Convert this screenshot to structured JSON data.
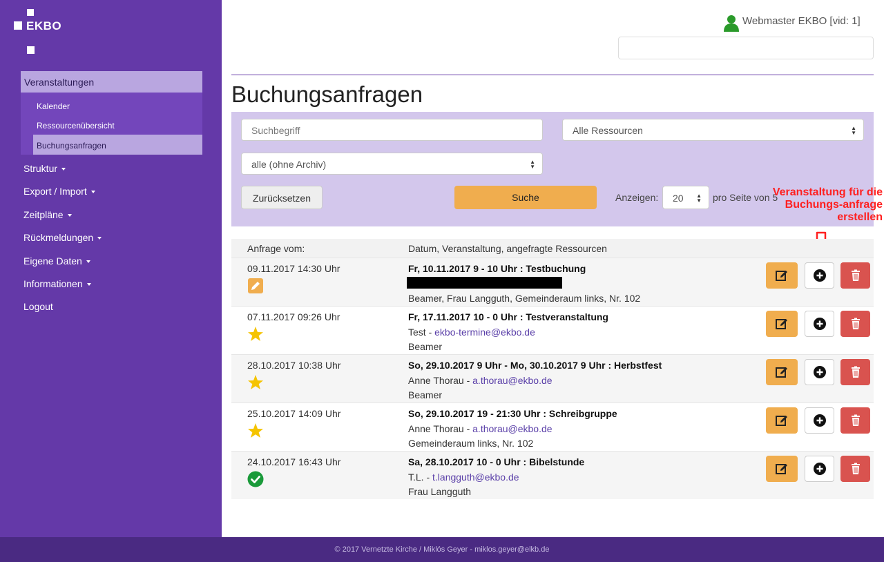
{
  "brand": {
    "logo_text": "EKBO"
  },
  "sidebar": {
    "main": "Veranstaltungen",
    "sub": [
      "Kalender",
      "Ressourcenübersicht",
      "Buchungsanfragen"
    ],
    "items": [
      "Struktur",
      "Export / Import",
      "Zeitpläne",
      "Rückmeldungen",
      "Eigene Daten",
      "Informationen",
      "Logout"
    ]
  },
  "user": {
    "name": "Webmaster EKBO [vid: 1]"
  },
  "page": {
    "title": "Buchungsanfragen"
  },
  "filter": {
    "search_placeholder": "Suchbegriff",
    "resources": "Alle Ressourcen",
    "archive": "alle (ohne Archiv)",
    "reset_label": "Zurücksetzen",
    "search_label": "Suche",
    "show_label": "Anzeigen:",
    "per_page_value": "20",
    "per_page_suffix": "pro Seite von 5"
  },
  "annotation": {
    "text": "Veranstaltung für die Buchungs-anfrage erstellen"
  },
  "table": {
    "col1": "Anfrage vom:",
    "col2": "Datum, Veranstaltung, angefragte Ressourcen",
    "rows": [
      {
        "date": "09.11.2017 14:30 Uhr",
        "status": "edit",
        "title": "Fr, 10.11.2017 9 - 10 Uhr : Testbuchung",
        "contact": "",
        "email": "",
        "resources": "Beamer, Frau Langguth, Gemeinderaum links, Nr. 102"
      },
      {
        "date": "07.11.2017 09:26 Uhr",
        "status": "star",
        "title": "Fr, 17.11.2017 10 - 0 Uhr : Testveranstaltung",
        "contact": "Test - ",
        "email": "ekbo-termine@ekbo.de",
        "resources": "Beamer"
      },
      {
        "date": "28.10.2017 10:38 Uhr",
        "status": "star",
        "title": "So, 29.10.2017 9 Uhr - Mo, 30.10.2017 9 Uhr : Herbstfest",
        "contact": "Anne Thorau - ",
        "email": "a.thorau@ekbo.de",
        "resources": "Beamer"
      },
      {
        "date": "25.10.2017 14:09 Uhr",
        "status": "star",
        "title": "So, 29.10.2017 19 - 21:30 Uhr : Schreibgruppe",
        "contact": "Anne Thorau - ",
        "email": "a.thorau@ekbo.de",
        "resources": "Gemeinderaum links, Nr. 102"
      },
      {
        "date": "24.10.2017 16:43 Uhr",
        "status": "check",
        "title": "Sa, 28.10.2017 10 - 0 Uhr : Bibelstunde",
        "contact": "T.L. - ",
        "email": "t.langguth@ekbo.de",
        "resources": "Frau Langguth"
      }
    ]
  },
  "footer": {
    "text": "© 2017 Vernetzte Kirche / Miklós Geyer - miklos.geyer@elkb.de"
  },
  "colors": {
    "sidebar": "#6439a8",
    "accent": "#f0ad4e",
    "danger": "#d9534f",
    "panel": "#d3c7ec"
  }
}
